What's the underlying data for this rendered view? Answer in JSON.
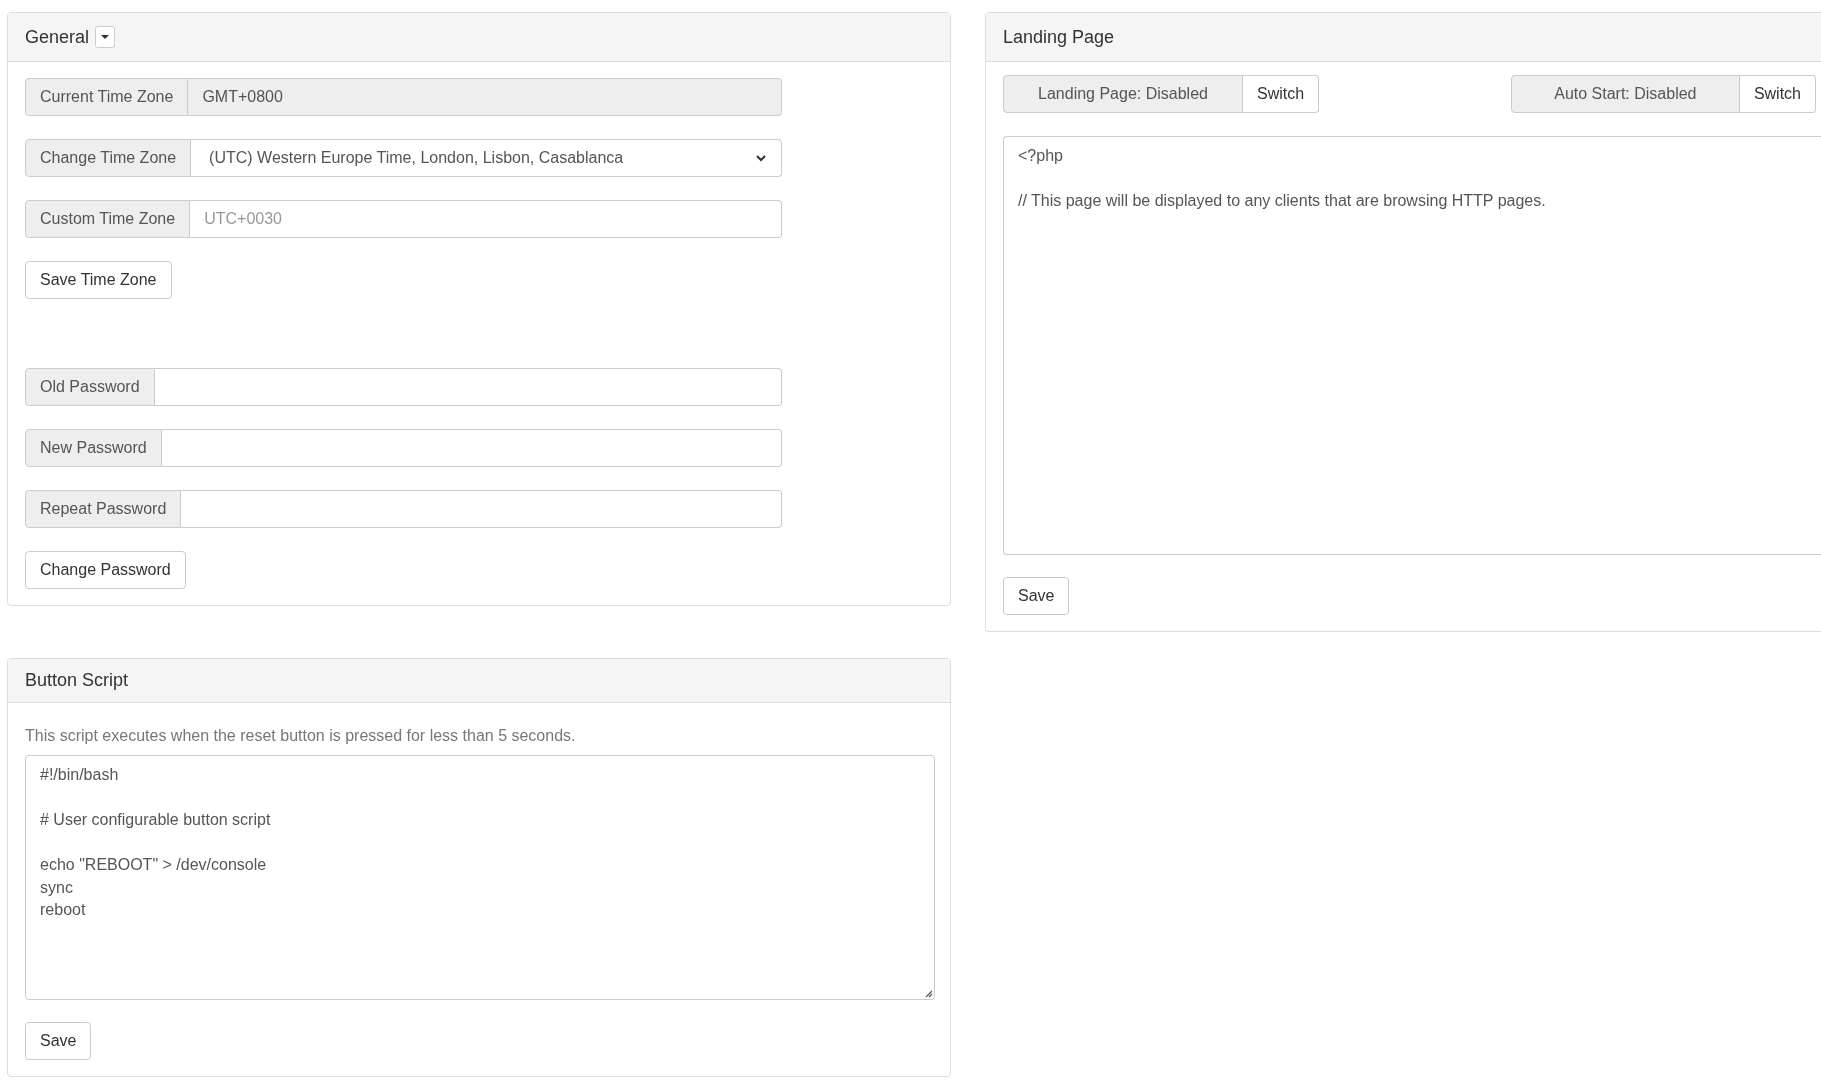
{
  "general": {
    "title": "General",
    "groups": [
      {
        "fields": [
          {
            "label": "Current Time Zone",
            "kind": "readonly",
            "value": "GMT+0800"
          },
          {
            "label": "Change Time Zone",
            "kind": "select",
            "value": "(UTC) Western Europe Time, London, Lisbon, Casablanca"
          },
          {
            "label": "Custom Time Zone",
            "kind": "text",
            "placeholder": "UTC+0030"
          }
        ],
        "button": "Save Time Zone"
      },
      {
        "fields": [
          {
            "label": "Old Password",
            "kind": "password"
          },
          {
            "label": "New Password",
            "kind": "password"
          },
          {
            "label": "Repeat Password",
            "kind": "password"
          }
        ],
        "button": "Change Password"
      }
    ]
  },
  "button_script": {
    "title": "Button Script",
    "description": "This script executes when the reset button is pressed for less than 5 seconds.",
    "script": "#!/bin/bash\n\n# User configurable button script\n\necho \"REBOOT\" > /dev/console\nsync\nreboot",
    "button": "Save"
  },
  "landing_page": {
    "title": "Landing Page",
    "toggles": [
      {
        "status": "Landing Page: Disabled",
        "button": "Switch"
      },
      {
        "status": "Auto Start: Disabled",
        "button": "Switch"
      }
    ],
    "script": "<?php\n\n// This page will be displayed to any clients that are browsing HTTP pages.",
    "button": "Save"
  }
}
